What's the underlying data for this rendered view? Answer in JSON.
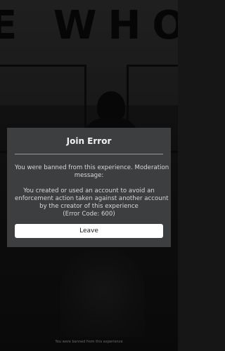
{
  "background": {
    "scene_text": "E WHO I"
  },
  "dialog": {
    "title": "Join Error",
    "message_lines": [
      "You were banned from this experience. Moderation",
      "message:",
      "",
      "You created or used an account to avoid an",
      "enforcement action taken against another account",
      "by the creator of this experience",
      "(Error Code: 600)"
    ],
    "leave_label": "Leave"
  },
  "status": {
    "bottom_text": "You were banned from this experience"
  },
  "colors": {
    "dialog_bg": "#3c3e40",
    "button_bg": "#ffffff",
    "title_text": "#f2f2f2",
    "body_text": "#d8d8d8"
  }
}
